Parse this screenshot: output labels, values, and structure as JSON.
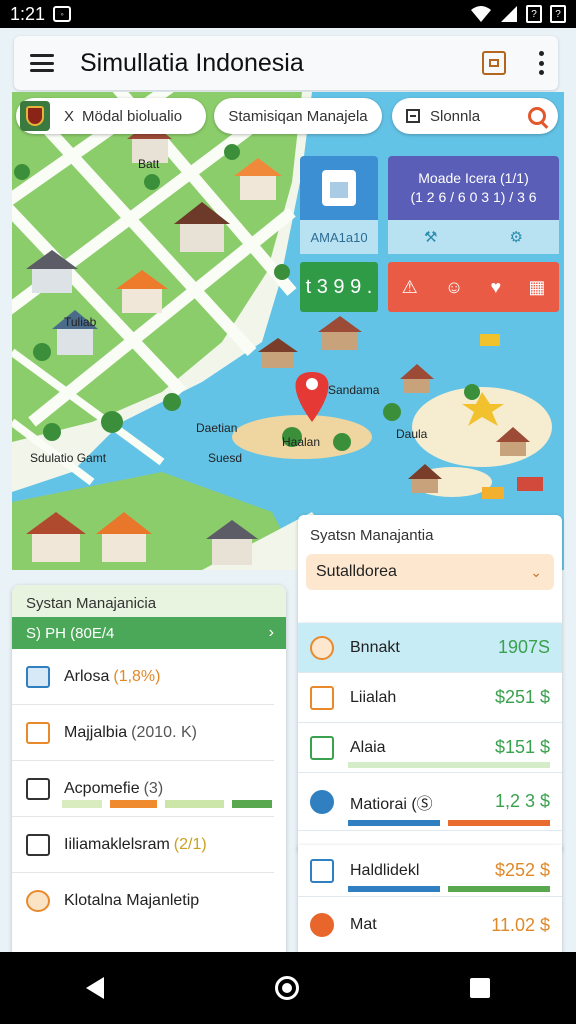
{
  "status": {
    "time": "1:21"
  },
  "app": {
    "title": "Simullatia Indonesia"
  },
  "chips": {
    "region": "Mödal biolualio",
    "region_prefix": "X",
    "mode": "Stamisiqan Manajela",
    "search": "Slonnla"
  },
  "tiles": {
    "blue_caption": "AMA1a10",
    "purple_line1": "Moade Icera (1/1)",
    "purple_line2": "(1 2 6 / 6 0 3 1) / 3 6",
    "green_value": "t 3 9 9 .",
    "red_icons": [
      "alert-icon",
      "people-icon",
      "heart-icon",
      "map-grid-icon"
    ]
  },
  "map": {
    "label_city": "Sandama",
    "label_left": "Daetian",
    "label_left2": "Suesd",
    "label_right": "Daula",
    "label_pin": "Haalan",
    "label_top": "Batt",
    "label_village": "Tuliab",
    "label_coast": "Sdulatio Gamt"
  },
  "left_panel": {
    "title": "Systan Manajanicia",
    "summary": "S) PH (80E/4",
    "rows": [
      {
        "label": "Arlosa",
        "value": "(1,8%)"
      },
      {
        "label": "Majjalbia",
        "value": "(2010. K)"
      },
      {
        "label": "Acpomefie",
        "value": "(3)"
      },
      {
        "label": "Iiliamaklelsram",
        "value": "(2/1)"
      },
      {
        "label": "Klotalna Majanletip",
        "value": ""
      }
    ]
  },
  "right_panel": {
    "title": "Syatsn Manajantia",
    "select": "Sutalldorea",
    "rows": [
      {
        "label": "Bnnakt",
        "amount": "1907S"
      },
      {
        "label": "Liialah",
        "amount": "$251 $"
      },
      {
        "label": "Alaia",
        "amount": "$151 $"
      },
      {
        "label": "Matiorai (Ⓢ",
        "amount": "1,2 3 $"
      },
      {
        "label": "Haldlidekl",
        "amount": "$252 $"
      },
      {
        "label": "Mat",
        "amount": "11.02 $"
      }
    ]
  },
  "colors": {
    "accent_green": "#4ca859",
    "accent_orange": "#e0892a",
    "water": "#5dc0e6",
    "land": "#8ccd6b"
  }
}
